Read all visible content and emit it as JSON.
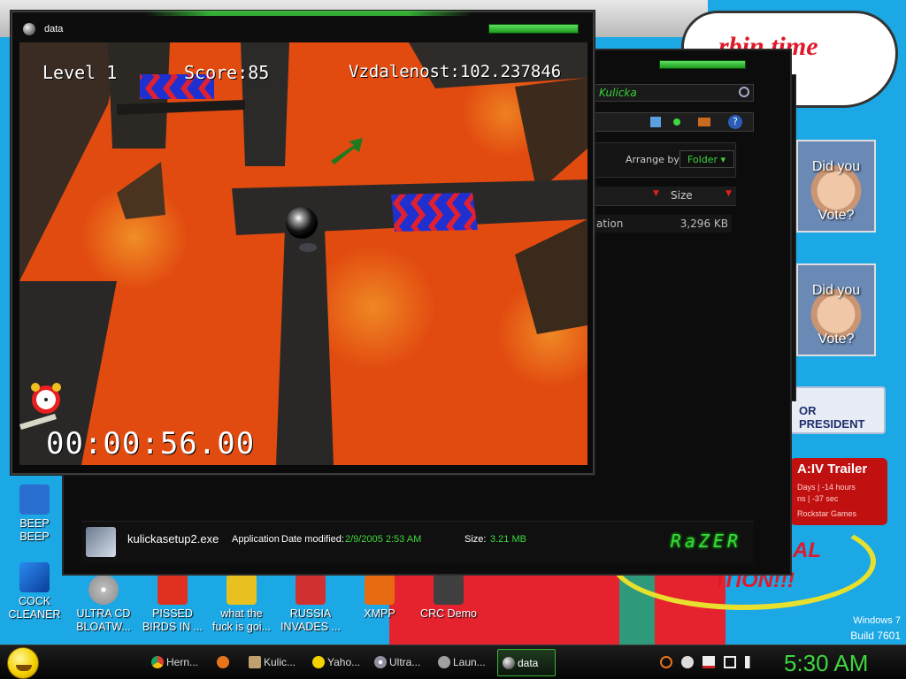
{
  "game": {
    "window_title": "data",
    "level": "Level 1",
    "score": "Score:85",
    "distance_label": "Vzdalenost:",
    "distance_value": "102.237846",
    "timer": "00:00:56.00"
  },
  "explorer": {
    "search_text": "Kulicka",
    "arrange_label": "Arrange by:",
    "arrange_value": "Folder",
    "size_header": "Size",
    "row_type": "ation",
    "row_size": "3,296 KB",
    "details": {
      "filename": "kulickasetup2.exe",
      "type": "Application",
      "date_modified_label": "Date modified:",
      "date_modified": "2/9/2005 2:53 AM",
      "size_label": "Size:",
      "size": "3.21 MB",
      "brand": "RaZER"
    }
  },
  "wallpaper": {
    "bubble_text": "rbin time",
    "vote1": [
      "Did you",
      "Vote?"
    ],
    "vote2": [
      "Did you",
      "Vote?"
    ],
    "president": "OR PRESIDENT",
    "gta_title": "A:IV Trailer",
    "gta_line1": "Days  | -14 hours",
    "gta_line2": "ns | -37 sec",
    "gta_line3": "Rockstar Games",
    "edition_line1": "AL",
    "edition_line2": "ITION!!!",
    "windows_line1": "Windows 7",
    "windows_line2": "Build 7601"
  },
  "desktop_icons": [
    {
      "label": "BEEP\nBEEP",
      "color": "#2a6fd0"
    },
    {
      "label": "COCK\nCLEANER",
      "color": "#1d64c8"
    },
    {
      "label": "ULTRA CD\nBLOATW...",
      "color": "#9a9aa0"
    },
    {
      "label": "PISSED\nBIRDS IN ...",
      "color": "#e03020"
    },
    {
      "label": "what the\nfuck is goi...",
      "color": "#e8c020"
    },
    {
      "label": "RUSSIA\nINVADES ...",
      "color": "#d03030"
    },
    {
      "label": "XMPP",
      "color": "#e86a10"
    },
    {
      "label": "CRC Demo",
      "color": "#404040"
    }
  ],
  "taskbar": {
    "items": [
      {
        "label": "Hern...",
        "color": "#e04030"
      },
      {
        "label": "",
        "color": "#e8741c"
      },
      {
        "label": "Kulic...",
        "color": "#c0a070"
      },
      {
        "label": "Yaho...",
        "color": "#f4d200"
      },
      {
        "label": "Ultra...",
        "color": "#9090a0"
      },
      {
        "label": "Laun...",
        "color": "#a0a0a0"
      },
      {
        "label": "data",
        "color": "#b0b0b0"
      }
    ],
    "clock": "5:30 AM"
  },
  "colors": {
    "accent": "#3fd63f",
    "lava": "#e24b10",
    "wallpaper": "#1ba8e5"
  }
}
